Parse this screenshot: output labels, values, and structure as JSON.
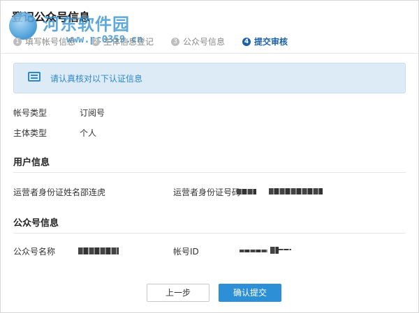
{
  "header": {
    "title": "登记公众号信息"
  },
  "watermark": {
    "site_name": "河东软件园",
    "url": "www.pc0359.cn"
  },
  "steps": [
    {
      "num": "1",
      "label": "填写帐号信息"
    },
    {
      "num": "2",
      "label": "主体信息登记"
    },
    {
      "num": "3",
      "label": "公众号信息"
    },
    {
      "num": "4",
      "label": "提交审核",
      "active": true
    }
  ],
  "banner": {
    "text": "请认真核对以下认证信息"
  },
  "account": {
    "type_label": "帐号类型",
    "type_value": "订阅号",
    "subject_label": "主体类型",
    "subject_value": "个人"
  },
  "user_info": {
    "section_title": "用户信息",
    "operator_name_label": "运营者身份证姓名",
    "operator_name_value": "邵连虎",
    "operator_id_label": "运营者身份证号码"
  },
  "official_info": {
    "section_title": "公众号信息",
    "name_label": "公众号名称",
    "account_id_label": "帐号ID"
  },
  "buttons": {
    "prev": "上一步",
    "confirm": "确认提交"
  },
  "colors": {
    "accent": "#2d8fd5",
    "banner_bg": "#dcebf6",
    "step_active": "#1a5fa8"
  }
}
